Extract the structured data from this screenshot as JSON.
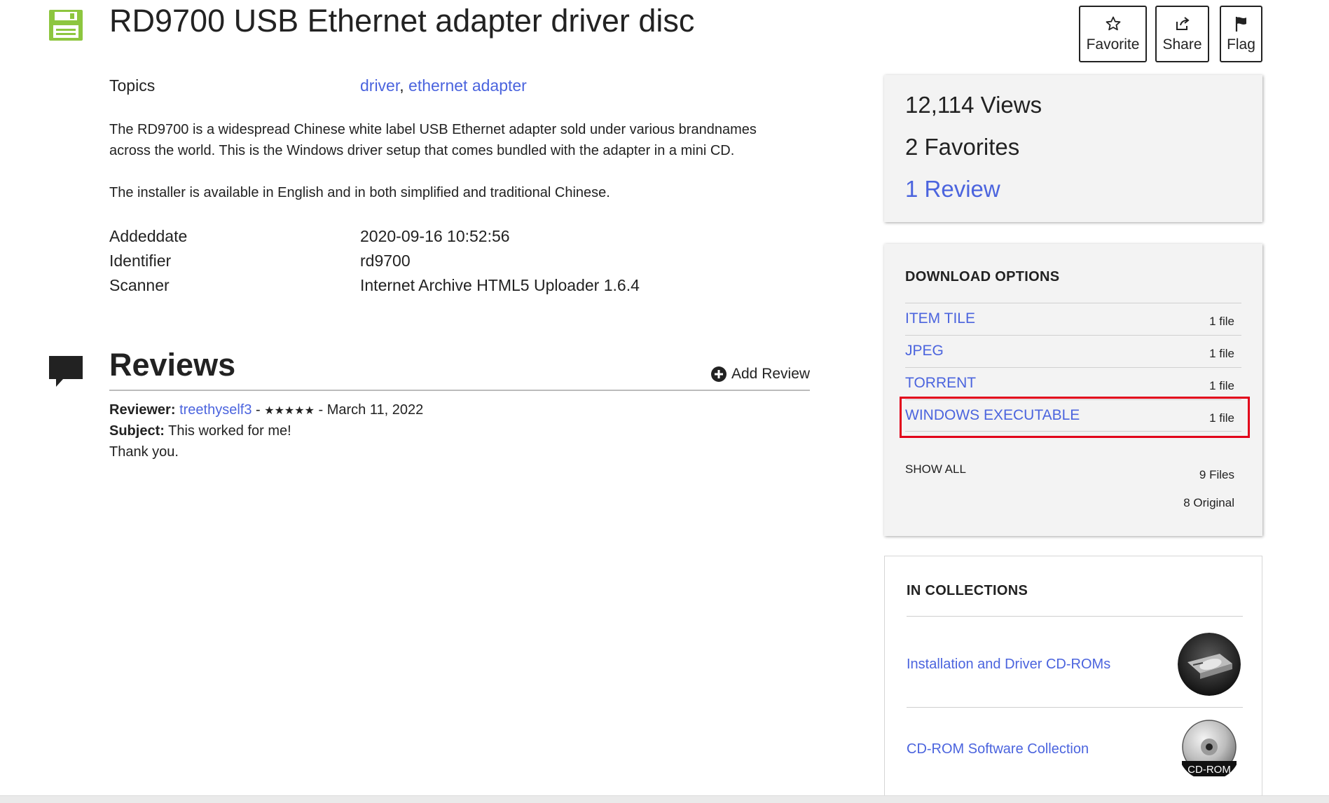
{
  "item": {
    "title": "RD9700 USB Ethernet adapter driver disc",
    "icon": "floppy-disk-icon"
  },
  "actions": {
    "favorite_label": "Favorite",
    "share_label": "Share",
    "flag_label": "Flag"
  },
  "metadata": {
    "topics_label": "Topics",
    "topics": [
      "driver",
      "ethernet adapter"
    ],
    "topics_separator": ",",
    "description_1_line_1": "The RD9700 is a widespread Chinese white label USB Ethernet adapter sold under various brandnames",
    "description_1_line_2": "across the world. This is the Windows driver setup that comes bundled with the adapter in a mini CD.",
    "description_2": "The installer is available in English and in both simplified and traditional Chinese.",
    "fields": [
      {
        "label": "Addeddate",
        "value": "2020-09-16 10:52:56"
      },
      {
        "label": "Identifier",
        "value": "rd9700"
      },
      {
        "label": "Scanner",
        "value": "Internet Archive HTML5 Uploader 1.6.4"
      }
    ]
  },
  "reviews": {
    "title": "Reviews",
    "add_review_label": "Add Review",
    "items": [
      {
        "reviewer_label": "Reviewer:",
        "reviewer": "treethyself3",
        "separator": " - ",
        "stars": "★★★★★",
        "date_text": " - March 11, 2022",
        "subject_label": "Subject:",
        "subject": " This worked for me!",
        "body": "Thank you."
      }
    ]
  },
  "stats": {
    "views": "12,114 Views",
    "favorites": "2 Favorites",
    "reviews": "1 Review"
  },
  "download_options": {
    "heading": "DOWNLOAD OPTIONS",
    "items": [
      {
        "label": "ITEM TILE",
        "count": "1 file"
      },
      {
        "label": "JPEG",
        "count": "1 file"
      },
      {
        "label": "TORRENT",
        "count": "1 file"
      },
      {
        "label": "WINDOWS EXECUTABLE",
        "count": "1 file",
        "highlighted": true
      }
    ],
    "show_all_label": "SHOW ALL",
    "files_count": "9 Files",
    "original_count": "8 Original"
  },
  "collections": {
    "heading": "IN COLLECTIONS",
    "items": [
      {
        "label": "Installation and Driver CD-ROMs",
        "thumb": "cd-drive-photo"
      },
      {
        "label": "CD-ROM Software Collection",
        "thumb": "cd-rom-disc-icon",
        "thumb_text": "CD-ROM"
      }
    ]
  },
  "colors": {
    "link": "#4b64de",
    "highlight_border": "#e2001a",
    "floppy_icon": "#8dc63f",
    "panel_bg": "#f3f3f3"
  }
}
